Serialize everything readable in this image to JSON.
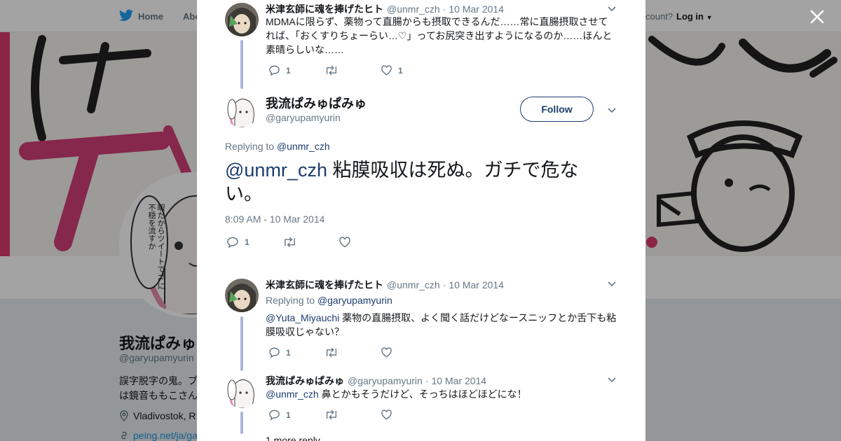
{
  "nav": {
    "home_label": "Home",
    "about_label": "Abo",
    "account_prompt": "count?",
    "login_label": "Log in"
  },
  "background_profile": {
    "name": "我流ぱみゅぱみゅ",
    "handle": "@garyupamyurin",
    "bio_line1": "誤字脱字の鬼。ブ",
    "bio_line2": "は鏡音ももこさん",
    "location": "Vladivostok, R",
    "url": "peing.net/ja/ga",
    "avatar_caption": "暇だからツイートでTLに不穏を流すか",
    "banner_glyph": "ダ"
  },
  "modal": {
    "parent_tweet": {
      "name": "米津玄師に魂を捧げたヒト",
      "handle": "@unmr_czh",
      "date": "10 Mar 2014",
      "text": "MDMAに限らず、薬物って直腸からも摂取できるんだ……常に直腸摂取させてれば、「おくすりちょーらい…♡」ってお尻突き出すようになるのか……ほんと素晴らしいな……",
      "reply_count": "1",
      "retweet_count": "",
      "like_count": "1"
    },
    "main_tweet": {
      "name": "我流ぱみゅぱみゅ",
      "handle": "@garyupamyurin",
      "follow_label": "Follow",
      "replying_prefix": "Replying to",
      "replying_handle": "@unmr_czh",
      "mention": "@unmr_czh",
      "text": "粘膜吸収は死ぬ。ガチで危ない。",
      "timestamp": "8:09 AM - 10 Mar 2014",
      "reply_count": "1"
    },
    "replies": [
      {
        "name": "米津玄師に魂を捧げたヒト",
        "handle": "@unmr_czh",
        "date": "10 Mar 2014",
        "replying_prefix": "Replying to",
        "replying_handle": "@garyupamyurin",
        "mention": "@Yuta_Miyauchi",
        "text": "薬物の直腸摂取、よく聞く話だけどなースニッフとか舌下も粘膜吸収じゃない？",
        "reply_count": "1"
      },
      {
        "name": "我流ぱみゅぱみゅ",
        "handle": "@garyupamyurin",
        "date": "10 Mar 2014",
        "mention": "@unmr_czh",
        "text": "鼻とかもそうだけど、そっちはほどほどにな！",
        "reply_count": "1"
      }
    ],
    "more_replies_label": "1 more reply"
  },
  "colors": {
    "link": "#1b95e0",
    "brand_blue": "#1c3d6e",
    "thread_line": "#aab8d6",
    "muted": "#657786"
  }
}
